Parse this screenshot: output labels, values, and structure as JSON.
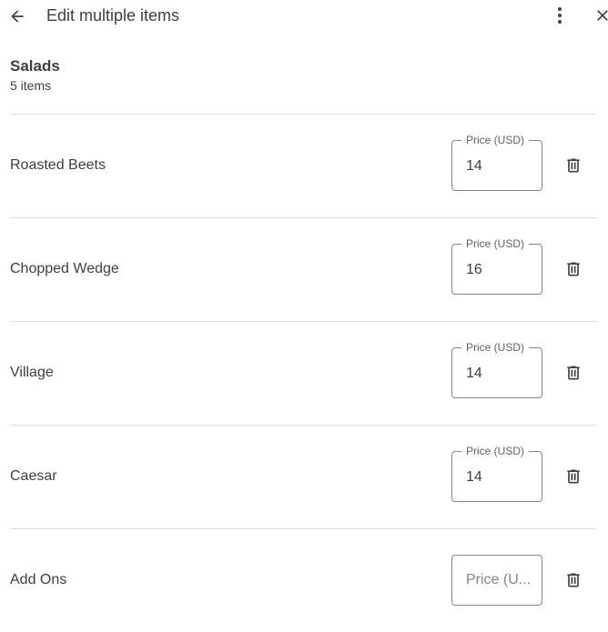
{
  "header": {
    "title": "Edit multiple items",
    "back_icon": "arrow-back-icon",
    "more_icon": "more-vert-icon",
    "close_icon": "close-icon"
  },
  "section": {
    "title": "Salads",
    "count": "5 items"
  },
  "price_label": "Price (USD)",
  "items": [
    {
      "name": "Roasted Beets",
      "price": "14"
    },
    {
      "name": "Chopped Wedge",
      "price": "16"
    },
    {
      "name": "Village",
      "price": "14"
    },
    {
      "name": "Caesar",
      "price": "14"
    },
    {
      "name": "Add Ons",
      "price": "",
      "placeholder": "Price (U..."
    }
  ],
  "colors": {
    "text": "#3c4043",
    "divider": "#dadce0",
    "field_border": "#80868b"
  }
}
